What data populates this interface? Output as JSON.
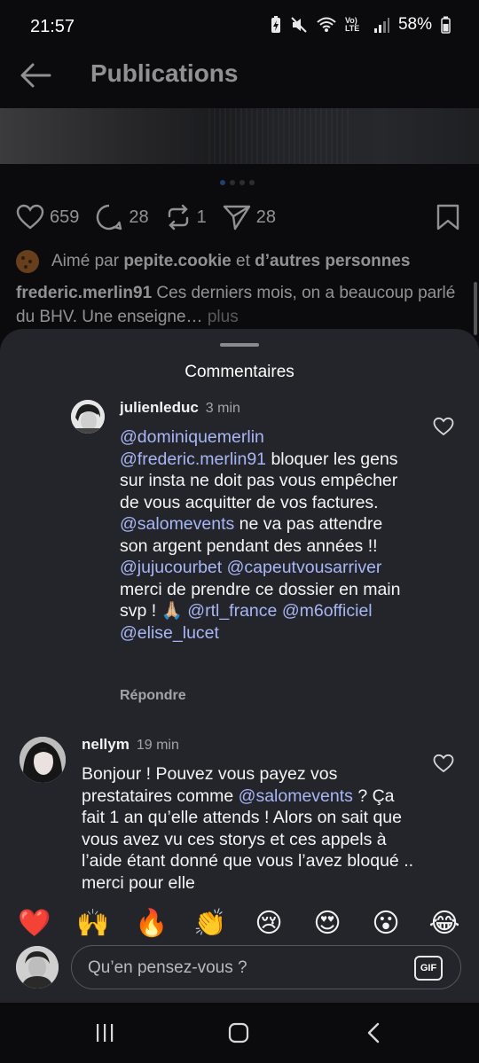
{
  "status": {
    "time": "21:57",
    "battery": "58%",
    "network": "Vo) LTE"
  },
  "header": {
    "title": "Publications"
  },
  "post": {
    "likes": "659",
    "comments": "28",
    "reposts": "1",
    "shares": "28",
    "liked_prefix": "Aimé par",
    "liked_user": "pepite.cookie",
    "liked_suffix": "et",
    "liked_others": "d’autres personnes",
    "caption_user": "frederic.merlin91",
    "caption_text": "Ces derniers mois, on a beaucoup parlé du BHV. Une enseigne…",
    "caption_more": "plus"
  },
  "sheet": {
    "title": "Commentaires"
  },
  "comments": [
    {
      "user": "julienleduc",
      "time": "3 min",
      "reply": "Répondre",
      "parts": [
        {
          "t": "@dominiquemerlin",
          "m": true
        },
        {
          "t": " ",
          "m": false
        },
        {
          "t": "@frederic.merlin91",
          "m": true
        },
        {
          "t": " bloquer les gens sur insta ne doit pas vous empêcher de vous acquitter de vos factures. ",
          "m": false
        },
        {
          "t": "@salomevents",
          "m": true
        },
        {
          "t": " ne va pas attendre son argent pendant des années !! ",
          "m": false
        },
        {
          "t": "@jujucourbet",
          "m": true
        },
        {
          "t": " ",
          "m": false
        },
        {
          "t": "@capeutvousarriver",
          "m": true
        },
        {
          "t": " merci de prendre ce dossier en main svp ! 🙏🏼 ",
          "m": false
        },
        {
          "t": "@rtl_france",
          "m": true
        },
        {
          "t": " ",
          "m": false
        },
        {
          "t": "@m6officiel",
          "m": true
        },
        {
          "t": " ",
          "m": false
        },
        {
          "t": "@elise_lucet",
          "m": true
        }
      ]
    },
    {
      "user": "nellym",
      "time": "19 min",
      "parts": [
        {
          "t": "Bonjour ! Pouvez vous payez vos prestataires comme ",
          "m": false
        },
        {
          "t": "@salomevents",
          "m": true
        },
        {
          "t": " ? Ça fait 1 an qu’elle attends ! Alors on sait que vous avez vu ces storys et ces appels à l’aide étant donné que vous l’avez bloqué .. merci pour elle",
          "m": false
        }
      ]
    }
  ],
  "emojis": [
    "❤️",
    "🙌",
    "🔥",
    "👏",
    "😢",
    "😍",
    "😮",
    "😂"
  ],
  "composer": {
    "placeholder": "Qu’en pensez-vous ?",
    "gif_label": "GIF"
  },
  "colors": {
    "sheet": "#23252b",
    "mention": "#a9b6f5",
    "background": "#0b0b0d"
  }
}
